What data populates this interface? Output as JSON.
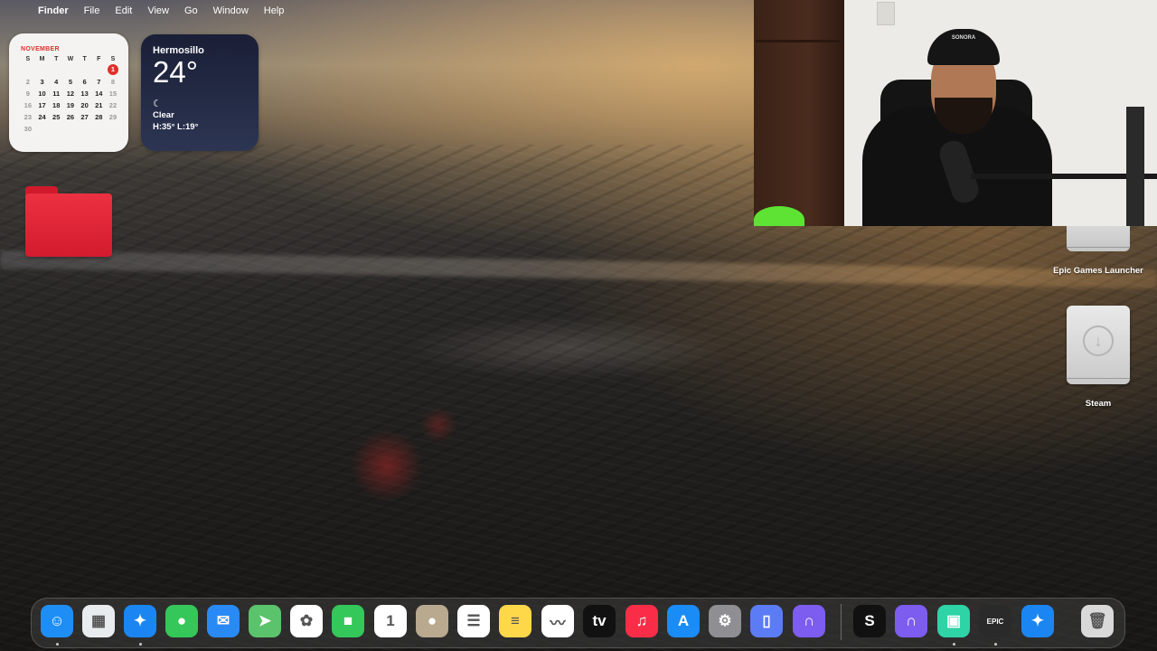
{
  "menubar": {
    "apple": "",
    "items": [
      "Finder",
      "File",
      "Edit",
      "View",
      "Go",
      "Window",
      "Help"
    ]
  },
  "calendar_widget": {
    "month": "NOVEMBER",
    "day_names": [
      "S",
      "M",
      "T",
      "W",
      "T",
      "F",
      "S"
    ],
    "weeks": [
      [
        "",
        "",
        "",
        "",
        "",
        "",
        "1"
      ],
      [
        "2",
        "3",
        "4",
        "5",
        "6",
        "7",
        "8"
      ],
      [
        "9",
        "10",
        "11",
        "12",
        "13",
        "14",
        "15"
      ],
      [
        "16",
        "17",
        "18",
        "19",
        "20",
        "21",
        "22"
      ],
      [
        "23",
        "24",
        "25",
        "26",
        "27",
        "28",
        "29"
      ],
      [
        "30",
        "",
        "",
        "",
        "",
        "",
        ""
      ]
    ],
    "today": "1",
    "accent": "#e0302b"
  },
  "weather_widget": {
    "city": "Hermosillo",
    "temperature": "24°",
    "condition_icon": "crescent-moon-icon",
    "condition": "Clear",
    "high_low": "H:35° L:19°"
  },
  "desktop_icons": {
    "folder": {
      "icon": "red-folder-icon",
      "color": "#e62d3d"
    },
    "epic": {
      "label": "Epic Games Launcher"
    },
    "steam": {
      "label": "Steam"
    }
  },
  "webcam": {
    "cap_text": "SONORA",
    "mic_color": "#222222",
    "accent_green": "#5ee234"
  },
  "dock": {
    "apps": [
      {
        "name": "Finder",
        "icon": "finder-icon",
        "bg": "#1e8ef5",
        "glyph": "☺",
        "running": true
      },
      {
        "name": "Launchpad",
        "icon": "launchpad-icon",
        "bg": "#e9ecef",
        "glyph": "▦",
        "running": false
      },
      {
        "name": "Safari",
        "icon": "safari-icon",
        "bg": "#1b86f2",
        "glyph": "✦",
        "running": true
      },
      {
        "name": "Messages",
        "icon": "messages-icon",
        "bg": "#35c759",
        "glyph": "●",
        "running": false
      },
      {
        "name": "Mail",
        "icon": "mail-icon",
        "bg": "#2a8af5",
        "glyph": "✉",
        "running": false
      },
      {
        "name": "Maps",
        "icon": "maps-icon",
        "bg": "#5ac36b",
        "glyph": "➤",
        "running": false
      },
      {
        "name": "Photos",
        "icon": "photos-icon",
        "bg": "#ffffff",
        "glyph": "✿",
        "running": false
      },
      {
        "name": "FaceTime",
        "icon": "facetime-icon",
        "bg": "#34c759",
        "glyph": "■",
        "running": false
      },
      {
        "name": "Calendar",
        "icon": "calendar-icon",
        "bg": "#ffffff",
        "glyph": "1",
        "running": false
      },
      {
        "name": "Contacts",
        "icon": "contacts-icon",
        "bg": "#b8a98f",
        "glyph": "●",
        "running": false
      },
      {
        "name": "Reminders",
        "icon": "reminders-icon",
        "bg": "#ffffff",
        "glyph": "☰",
        "running": false
      },
      {
        "name": "Notes",
        "icon": "notes-icon",
        "bg": "#ffd84a",
        "glyph": "≡",
        "running": false
      },
      {
        "name": "Freeform",
        "icon": "freeform-icon",
        "bg": "#ffffff",
        "glyph": "〰",
        "running": false
      },
      {
        "name": "Apple TV",
        "icon": "apple-tv-icon",
        "bg": "#111111",
        "glyph": "tv",
        "running": false
      },
      {
        "name": "Music",
        "icon": "music-icon",
        "bg": "#fa2d48",
        "glyph": "♫",
        "running": false
      },
      {
        "name": "App Store",
        "icon": "app-store-icon",
        "bg": "#1a8cf5",
        "glyph": "A",
        "running": false
      },
      {
        "name": "System Settings",
        "icon": "gear-icon",
        "bg": "#8e8e93",
        "glyph": "⚙",
        "running": false
      },
      {
        "name": "iPhone Mirroring",
        "icon": "iphone-mirroring-icon",
        "bg": "#5b7cf5",
        "glyph": "▯",
        "running": false
      },
      {
        "name": "Arc",
        "icon": "arc-icon",
        "bg": "#7d5cf0",
        "glyph": "∩",
        "running": false
      },
      {
        "name": "Scrivener",
        "icon": "s-app-icon",
        "bg": "#111111",
        "glyph": "S",
        "running": false
      },
      {
        "name": "Arc Alt",
        "icon": "arc-alt-icon",
        "bg": "#7d5cf0",
        "glyph": "∩",
        "running": false
      },
      {
        "name": "Codecov",
        "icon": "codecov-icon",
        "bg": "#2ed3a6",
        "glyph": "▣",
        "running": true
      },
      {
        "name": "Epic Games",
        "icon": "epic-games-icon",
        "bg": "#2a2a2a",
        "glyph": "EPIC",
        "running": true
      },
      {
        "name": "Safari Download",
        "icon": "safari-download-icon",
        "bg": "#1b86f2",
        "glyph": "✦",
        "running": false
      },
      {
        "name": "Trash",
        "icon": "trash-icon",
        "bg": "#d9d9d9",
        "glyph": "🗑",
        "running": false
      }
    ]
  }
}
